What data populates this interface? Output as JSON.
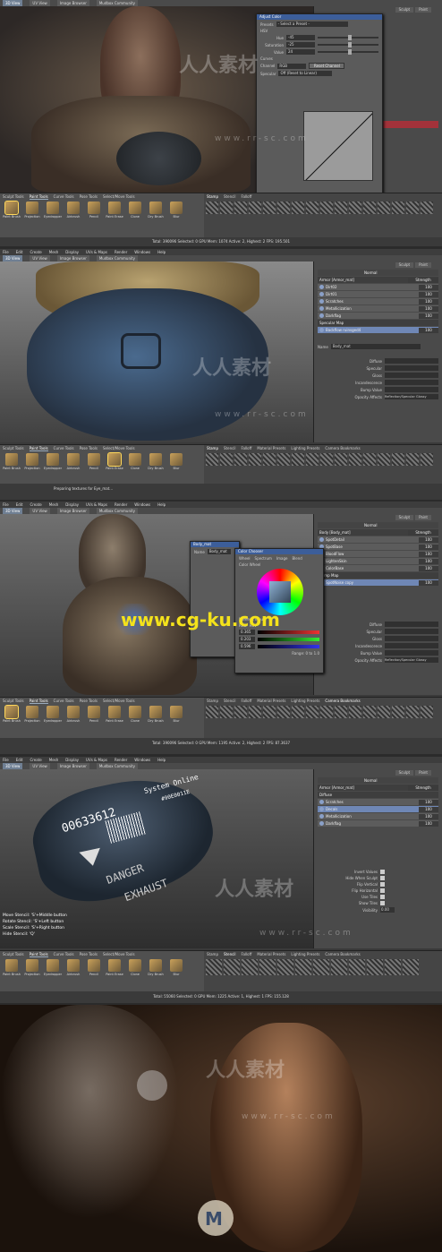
{
  "watermark": {
    "brand": "人人素材",
    "url": "www.rr-sc.com",
    "url_cg": "www.cg-ku.com"
  },
  "panel1": {
    "menu": [
      "3D View",
      "UV View",
      "Image Browser",
      "Mudbox Community"
    ],
    "right_tabs": [
      "Sculpt",
      "Paint"
    ],
    "dialog": {
      "title": "Adjust Color",
      "preset_label": "Presets",
      "preset_value": "- Select a Preset -",
      "hsv_label": "HSV",
      "hue_label": "Hue",
      "hue_value": "-45",
      "sat_label": "Saturation",
      "sat_value": "-25",
      "val_label": "Value",
      "val_value": "24",
      "curves_label": "Curves",
      "channel_label": "Channel",
      "channel_value": "RGB",
      "reset_label": "Reset Channel",
      "specular_label": "Specular",
      "specular_value": "Off (Reset to Linear)",
      "preview_label": "Preview",
      "help": "Help",
      "ok": "OK",
      "cancel": "Cancel"
    },
    "shelf_tabs": [
      "Sculpt Tools",
      "Paint Tools",
      "Curve Tools",
      "Pose Tools",
      "Select/Move Tools"
    ],
    "tools": [
      "Paint Brush",
      "Projection",
      "Eyedropper",
      "Airbrush",
      "Pencil",
      "Paint Erase",
      "Clone",
      "Dry Brush",
      "Blur"
    ],
    "stamp_tabs": [
      "Stamp",
      "Stencil",
      "Falloff"
    ],
    "status": "Total: 390096  Selected: 0  GPU Mem: 1074  Active: 2, Highest: 2  FPS: 195.501"
  },
  "panel2": {
    "menu": [
      "File",
      "Edit",
      "Create",
      "Mesh",
      "Display",
      "UVs & Maps",
      "Render",
      "Windows",
      "Help"
    ],
    "tabs": [
      "3D View",
      "UV View",
      "Image Browser",
      "Mudbox Community"
    ],
    "right_tabs": [
      "Sculpt",
      "Paint"
    ],
    "blend": "Normal",
    "layer_header": "Armor [Armor_mat]",
    "strength": "Strength",
    "layers": [
      {
        "name": "Dirt02",
        "val": "100"
      },
      {
        "name": "Dirt01",
        "val": "100"
      },
      {
        "name": "Scratches",
        "val": "100"
      },
      {
        "name": "Metallicization",
        "val": "100"
      },
      {
        "name": "Darkflag",
        "val": "100"
      }
    ],
    "spec_map": "Specular Map",
    "sel_layer": "Backflow ruinsged4",
    "sel_val": "100",
    "name_label": "Name",
    "name_value": "Body_mat",
    "props": [
      "Diffuse",
      "Specular",
      "Gloss",
      "Incandescence",
      "Bump Value",
      "Opacity Affects"
    ],
    "opacity_value": "Reflection/Specular Glossy",
    "shelf_tabs": [
      "Sculpt Tools",
      "Paint Tools",
      "Curve Tools",
      "Pose Tools",
      "Select/Move Tools"
    ],
    "tools": [
      "Paint Brush",
      "Projection",
      "Eyedropper",
      "Airbrush",
      "Pencil",
      "Paint Erase",
      "Clone",
      "Dry Brush",
      "Blur"
    ],
    "stamp_tabs": [
      "Stamp",
      "Stencil",
      "Falloff",
      "Material Presets",
      "Lighting Presets",
      "Camera Bookmarks"
    ],
    "status": "Preparing textures for Eye_mat..."
  },
  "panel3": {
    "menu": [
      "File",
      "Edit",
      "Create",
      "Mesh",
      "Display",
      "UVs & Maps",
      "Render",
      "Windows",
      "Help"
    ],
    "tabs": [
      "3D View",
      "UV View",
      "Image Browser",
      "Mudbox Community"
    ],
    "right_tabs": [
      "Sculpt",
      "Paint"
    ],
    "blend": "Normal",
    "layer_header": "Body [Body_mat]",
    "strength": "Strength",
    "layers": [
      {
        "name": "SpotDetail",
        "val": "100"
      },
      {
        "name": "SpotBase",
        "val": "100"
      },
      {
        "name": "BloodFlow",
        "val": "100"
      },
      {
        "name": "LightenSkin",
        "val": "100"
      },
      {
        "name": "ColorBase",
        "val": "100"
      }
    ],
    "bump_map": "Bump Map",
    "sel_layer": "SpotNoise copy",
    "sel_val": "100",
    "body_dialog_title": "Body_mat",
    "body_name_label": "Name",
    "body_name_value": "Body_mat",
    "color_chooser_title": "Color Chooser",
    "color_tabs": [
      "Wheel",
      "Spectrum",
      "Image",
      "Blend"
    ],
    "color_wheel_label": "Color Wheel",
    "numeric_label": "Numeric Input",
    "rgb_label": "RGB",
    "hsv_label": "HSV",
    "r_val": "0.365",
    "g_val": "0.203",
    "b_val": "0.596",
    "range_label": "Range: 0 to 1.0",
    "props": [
      "Diffuse",
      "Specular",
      "Gloss",
      "Incandescence",
      "Bump Value",
      "Opacity Affects"
    ],
    "opacity_value": "Reflection/Specular Glossy",
    "shelf_tabs": [
      "Sculpt Tools",
      "Paint Tools",
      "Curve Tools",
      "Pose Tools",
      "Select/Move Tools"
    ],
    "tools": [
      "Paint Brush",
      "Projection",
      "Eyedropper",
      "Airbrush",
      "Pencil",
      "Paint Erase",
      "Clone",
      "Dry Brush",
      "Blur"
    ],
    "stamp_tabs": [
      "Stamp",
      "Stencil",
      "Falloff",
      "Material Presets",
      "Lighting Presets",
      "Camera Bookmarks"
    ],
    "status": "Total: 390096  Selected: 0  GPU Mem: 1195  Active: 2, Highest: 2  FPS: 87.3637"
  },
  "panel4": {
    "menu": [
      "File",
      "Edit",
      "Create",
      "Mesh",
      "Display",
      "UVs & Maps",
      "Render",
      "Windows",
      "Help"
    ],
    "tabs": [
      "3D View",
      "UV View",
      "Image Browser",
      "Mudbox Community"
    ],
    "right_tabs": [
      "Sculpt",
      "Paint"
    ],
    "blend": "Normal",
    "layer_header": "Armor [Armor_mat]",
    "strength": "Strength",
    "diffuse_group": "Diffuse",
    "layers": [
      {
        "name": "Scratches",
        "val": "100"
      },
      {
        "name": "Decals",
        "val": "100"
      },
      {
        "name": "Metallicization",
        "val": "100"
      },
      {
        "name": "Darkflag",
        "val": "100"
      }
    ],
    "sel_index": 1,
    "stencil_props": [
      "Invert Values",
      "Hide When Sculpt",
      "Flip Vertical",
      "Flip Horizontal",
      "Use Tiles",
      "Show Tiles",
      "Visibility"
    ],
    "visibility_value": "0.00",
    "decal_number": "00633612",
    "decal_text1": "System Online",
    "decal_text2": "#90E0011E",
    "decal_text3": "DANGER",
    "decal_text4": "EXHAUST",
    "hints": [
      "Move Stencil: 'S'+Middle button",
      "Rotate Stencil: 'S'+Left button",
      "Scale Stencil: 'S'+Right button",
      "",
      "Hide Stencil: 'Q'"
    ],
    "shelf_tabs": [
      "Sculpt Tools",
      "Paint Tools",
      "Curve Tools",
      "Pose Tools",
      "Select/Move Tools"
    ],
    "tools": [
      "Paint Brush",
      "Projection",
      "Eyedropper",
      "Airbrush",
      "Pencil",
      "Paint Erase",
      "Clone",
      "Dry Brush",
      "Blur"
    ],
    "stamp_tabs": [
      "Stamp",
      "Stencil",
      "Falloff",
      "Material Presets",
      "Lighting Presets",
      "Camera Bookmarks"
    ],
    "status": "Total: 55060  Selected: 0  GPU Mem: 1225  Active: 1, Highest: 1  FPS: 155.128"
  }
}
